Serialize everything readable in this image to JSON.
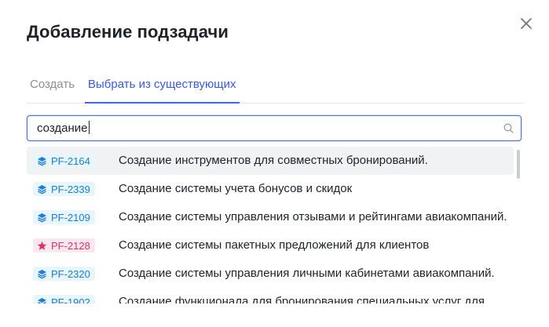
{
  "dialog": {
    "title": "Добавление подзадачи"
  },
  "tabs": [
    {
      "label": "Создать",
      "active": false
    },
    {
      "label": "Выбрать из существующих",
      "active": true
    }
  ],
  "search": {
    "value": "создание"
  },
  "results": [
    {
      "key": "PF-2164",
      "type_icon": "layers-icon",
      "title": "Создание инструментов для совместных бронирований.",
      "highlighted": true
    },
    {
      "key": "PF-2339",
      "type_icon": "layers-icon",
      "title": "Создание системы учета бонусов и скидок",
      "highlighted": false
    },
    {
      "key": "PF-2109",
      "type_icon": "layers-icon",
      "title": "Создание системы управления отзывами и рейтингами авиакомпаний.",
      "highlighted": false
    },
    {
      "key": "PF-2128",
      "type_icon": "star-icon",
      "title": "Создание системы пакетных предложений для клиентов",
      "highlighted": false
    },
    {
      "key": "PF-2320",
      "type_icon": "layers-icon",
      "title": "Создание системы управления личными кабинетами авиакомпаний.",
      "highlighted": false
    },
    {
      "key": "PF-1902",
      "type_icon": "layers-icon",
      "title": "Создание функционала для бронирования специальных услуг для",
      "highlighted": false
    }
  ],
  "colors": {
    "accent": "#4263eb",
    "story_badge_bg": "#e6f6fb",
    "story_badge_text": "#1c7ed6",
    "epic_badge_bg": "#fde7ee",
    "epic_badge_text": "#d6336c"
  }
}
